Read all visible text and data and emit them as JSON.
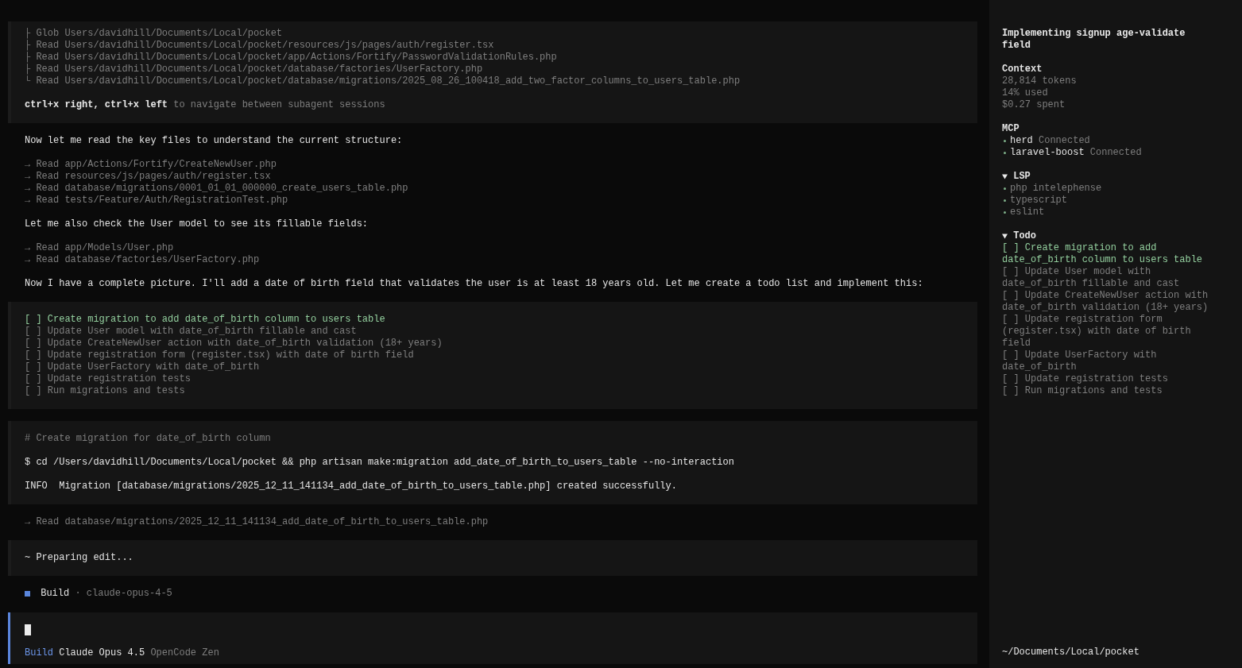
{
  "transcript": [
    {
      "kind": "tool_panel",
      "lines": [
        {
          "branch": "├",
          "text": "Glob Users/davidhill/Documents/Local/pocket"
        },
        {
          "branch": "├",
          "text": "Read Users/davidhill/Documents/Local/pocket/resources/js/pages/auth/register.tsx"
        },
        {
          "branch": "├",
          "text": "Read Users/davidhill/Documents/Local/pocket/app/Actions/Fortify/PasswordValidationRules.php"
        },
        {
          "branch": "├",
          "text": "Read Users/davidhill/Documents/Local/pocket/database/factories/UserFactory.php"
        },
        {
          "branch": "└",
          "text": "Read Users/davidhill/Documents/Local/pocket/database/migrations/2025_08_26_100418_add_two_factor_columns_to_users_table.php"
        }
      ],
      "hint": "**ctrl+x right, ctrl+x left** to navigate between subagent sessions"
    },
    {
      "kind": "message",
      "text": "Now let me read the key files to understand the current structure:"
    },
    {
      "kind": "tool_calls",
      "lines": [
        "→ Read app/Actions/Fortify/CreateNewUser.php",
        "→ Read resources/js/pages/auth/register.tsx",
        "→ Read database/migrations/0001_01_01_000000_create_users_table.php",
        "→ Read tests/Feature/Auth/RegistrationTest.php"
      ]
    },
    {
      "kind": "message",
      "text": "Let me also check the User model to see its fillable fields:"
    },
    {
      "kind": "tool_calls",
      "lines": [
        "→ Read app/Models/User.php",
        "→ Read database/factories/UserFactory.php"
      ]
    },
    {
      "kind": "message",
      "text": "Now I have a complete picture. I'll add a date of birth field that validates the user is at least 18 years old. Let me create a todo list and implement this:"
    },
    {
      "kind": "todo_panel",
      "items": [
        {
          "box": "[ ]",
          "text": "Create migration to add date_of_birth column to users table",
          "active": true
        },
        {
          "box": "[ ]",
          "text": "Update User model with date_of_birth fillable and cast",
          "active": false
        },
        {
          "box": "[ ]",
          "text": "Update CreateNewUser action with date_of_birth validation (18+ years)",
          "active": false
        },
        {
          "box": "[ ]",
          "text": "Update registration form (register.tsx) with date of birth field",
          "active": false
        },
        {
          "box": "[ ]",
          "text": "Update UserFactory with date_of_birth",
          "active": false
        },
        {
          "box": "[ ]",
          "text": "Update registration tests",
          "active": false
        },
        {
          "box": "[ ]",
          "text": "Run migrations and tests",
          "active": false
        }
      ]
    },
    {
      "kind": "bash_panel",
      "comment": "# Create migration for date_of_birth column",
      "command": "$ cd /Users/davidhill/Documents/Local/pocket && php artisan make:migration add_date_of_birth_to_users_table --no-interaction",
      "output": "INFO  Migration [database/migrations/2025_12_11_141134_add_date_of_birth_to_users_table.php] created successfully."
    },
    {
      "kind": "tool_calls",
      "lines": [
        "→ Read database/migrations/2025_12_11_141134_add_date_of_birth_to_users_table.php"
      ]
    },
    {
      "kind": "status_panel",
      "text": "~ Preparing edit..."
    },
    {
      "kind": "agent_line",
      "mode": "Build",
      "separator": "·",
      "model": "claude-opus-4-5"
    }
  ],
  "prompt": {
    "mode": "Build",
    "model": "Claude Opus 4.5",
    "provider": "OpenCode Zen"
  },
  "sidebar": {
    "title": "Implementing signup age-validate field",
    "context": {
      "heading": "Context",
      "lines": [
        "28,814 tokens",
        "14% used",
        "$0.27 spent"
      ]
    },
    "mcp": {
      "heading": "MCP",
      "servers": [
        {
          "name": "herd",
          "status": "Connected"
        },
        {
          "name": "laravel-boost",
          "status": "Connected"
        }
      ]
    },
    "lsp": {
      "heading": "LSP",
      "expanded": true,
      "items": [
        "php intelephense",
        "typescript",
        "eslint"
      ]
    },
    "todo": {
      "heading": "Todo",
      "expanded": true,
      "items": [
        {
          "box": "[ ]",
          "text": "Create migration to add date_of_birth column to users table",
          "active": true
        },
        {
          "box": "[ ]",
          "text": "Update User model with date_of_birth fillable and cast",
          "active": false
        },
        {
          "box": "[ ]",
          "text": "Update CreateNewUser action with date_of_birth validation (18+ years)",
          "active": false
        },
        {
          "box": "[ ]",
          "text": "Update registration form (register.tsx) with date of birth field",
          "active": false
        },
        {
          "box": "[ ]",
          "text": "Update UserFactory with date_of_birth",
          "active": false
        },
        {
          "box": "[ ]",
          "text": "Update registration tests",
          "active": false
        },
        {
          "box": "[ ]",
          "text": "Run migrations and tests",
          "active": false
        }
      ]
    },
    "path": "~/Documents/Local/pocket"
  }
}
